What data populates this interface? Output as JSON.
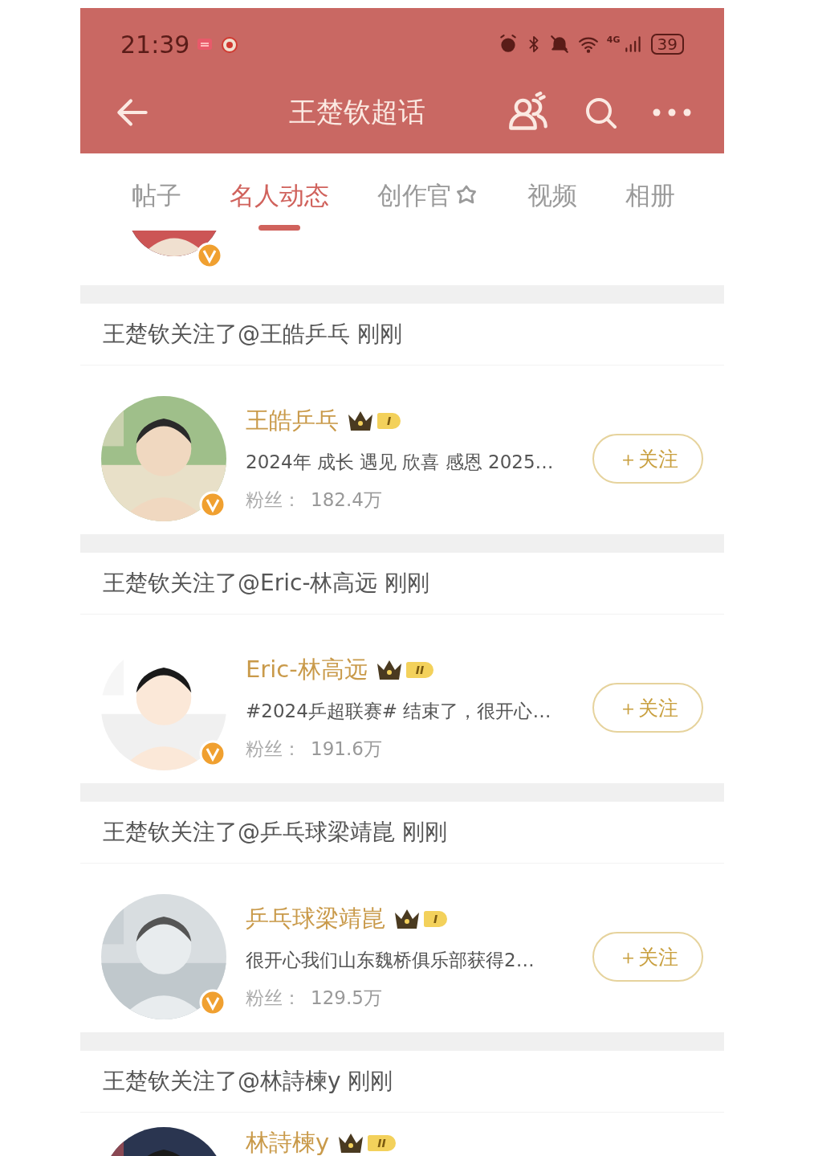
{
  "status_bar": {
    "time": "21:39",
    "network": "4G",
    "battery": "39"
  },
  "header": {
    "title": "王楚钦超话"
  },
  "tabs": [
    {
      "label": "帖子",
      "selected": false,
      "kind": "text"
    },
    {
      "label": "名人动态",
      "selected": true,
      "kind": "text"
    },
    {
      "label": "创作官",
      "selected": false,
      "kind": "icon"
    },
    {
      "label": "视频",
      "selected": false,
      "kind": "text"
    },
    {
      "label": "相册",
      "selected": false,
      "kind": "text"
    }
  ],
  "follows": [
    {
      "kind": "full",
      "activity": "王楚钦关注了@王皓乒乓 刚刚",
      "name": "王皓乒乓",
      "rank": "I",
      "bio": "2024年 成长 遇见 欣喜 感恩 2025…",
      "fans_label": "粉丝：",
      "fans": "182.4万",
      "button": "＋关注"
    },
    {
      "kind": "full",
      "activity": "王楚钦关注了@Eric-林高远 刚刚",
      "name": "Eric-林高远",
      "rank": "II",
      "bio": "#2024乒超联赛# 结束了，很开心…",
      "fans_label": "粉丝：",
      "fans": "191.6万",
      "button": "＋关注"
    },
    {
      "kind": "full",
      "activity": "王楚钦关注了@乒乓球梁靖崑 刚刚",
      "name": "乒乓球梁靖崑",
      "rank": "I",
      "bio": "很开心我们山东魏桥俱乐部获得2…",
      "fans_label": "粉丝：",
      "fans": "129.5万",
      "button": "＋关注"
    },
    {
      "kind": "cut",
      "activity": "王楚钦关注了@林詩楝y 刚刚",
      "name": "林詩楝y",
      "rank": "II"
    }
  ]
}
